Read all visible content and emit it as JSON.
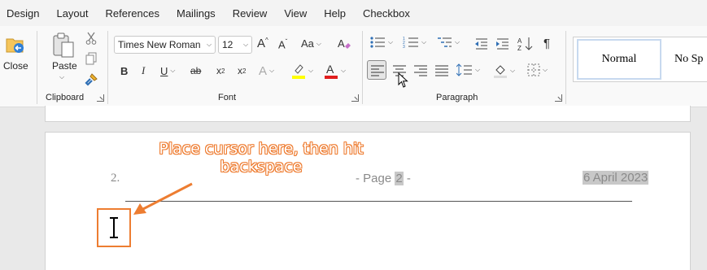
{
  "menu": [
    "Design",
    "Layout",
    "References",
    "Mailings",
    "Review",
    "View",
    "Help",
    "Checkbox"
  ],
  "close": {
    "label": "Close"
  },
  "clipboard": {
    "paste_label": "Paste",
    "group_label": "Clipboard"
  },
  "font": {
    "name": "Times New Roman",
    "size": "12",
    "group_label": "Font",
    "case_label": "Aa"
  },
  "paragraph": {
    "group_label": "Paragraph"
  },
  "styles": {
    "normal": "Normal",
    "no_spacing": "No Sp"
  },
  "document": {
    "header_number": "2.",
    "page_prefix": "- Page ",
    "page_number": "2",
    "page_suffix": " -",
    "date": "6 April 2023"
  },
  "annotation": {
    "line1": "Place cursor here, then hit",
    "line2": "backspace"
  },
  "colors": {
    "accent": "#ed7d31",
    "highlight": "#ffff00",
    "font_color": "#e01e1e"
  }
}
